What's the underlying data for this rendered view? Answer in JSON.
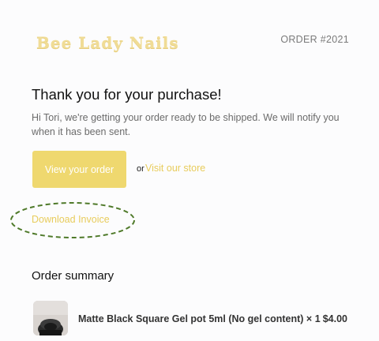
{
  "header": {
    "logo_text": "Bee Lady Nails",
    "order_number": "ORDER #2021"
  },
  "main": {
    "title": "Thank you for your purchase!",
    "message": "Hi Tori, we're getting your order ready to be shipped. We will notify you when it has been sent.",
    "view_order_label": "View your order",
    "or_text": "or",
    "visit_store_label": "Visit our store",
    "download_invoice_label": "Download Invoice"
  },
  "summary": {
    "title": "Order summary",
    "items": [
      {
        "name": "Matte Black Square Gel pot 5ml (No gel content) × 1",
        "price": "$4.00"
      }
    ]
  },
  "colors": {
    "accent": "#efd86f",
    "link": "#e8cc5c",
    "annotation": "#4f7a2a"
  }
}
